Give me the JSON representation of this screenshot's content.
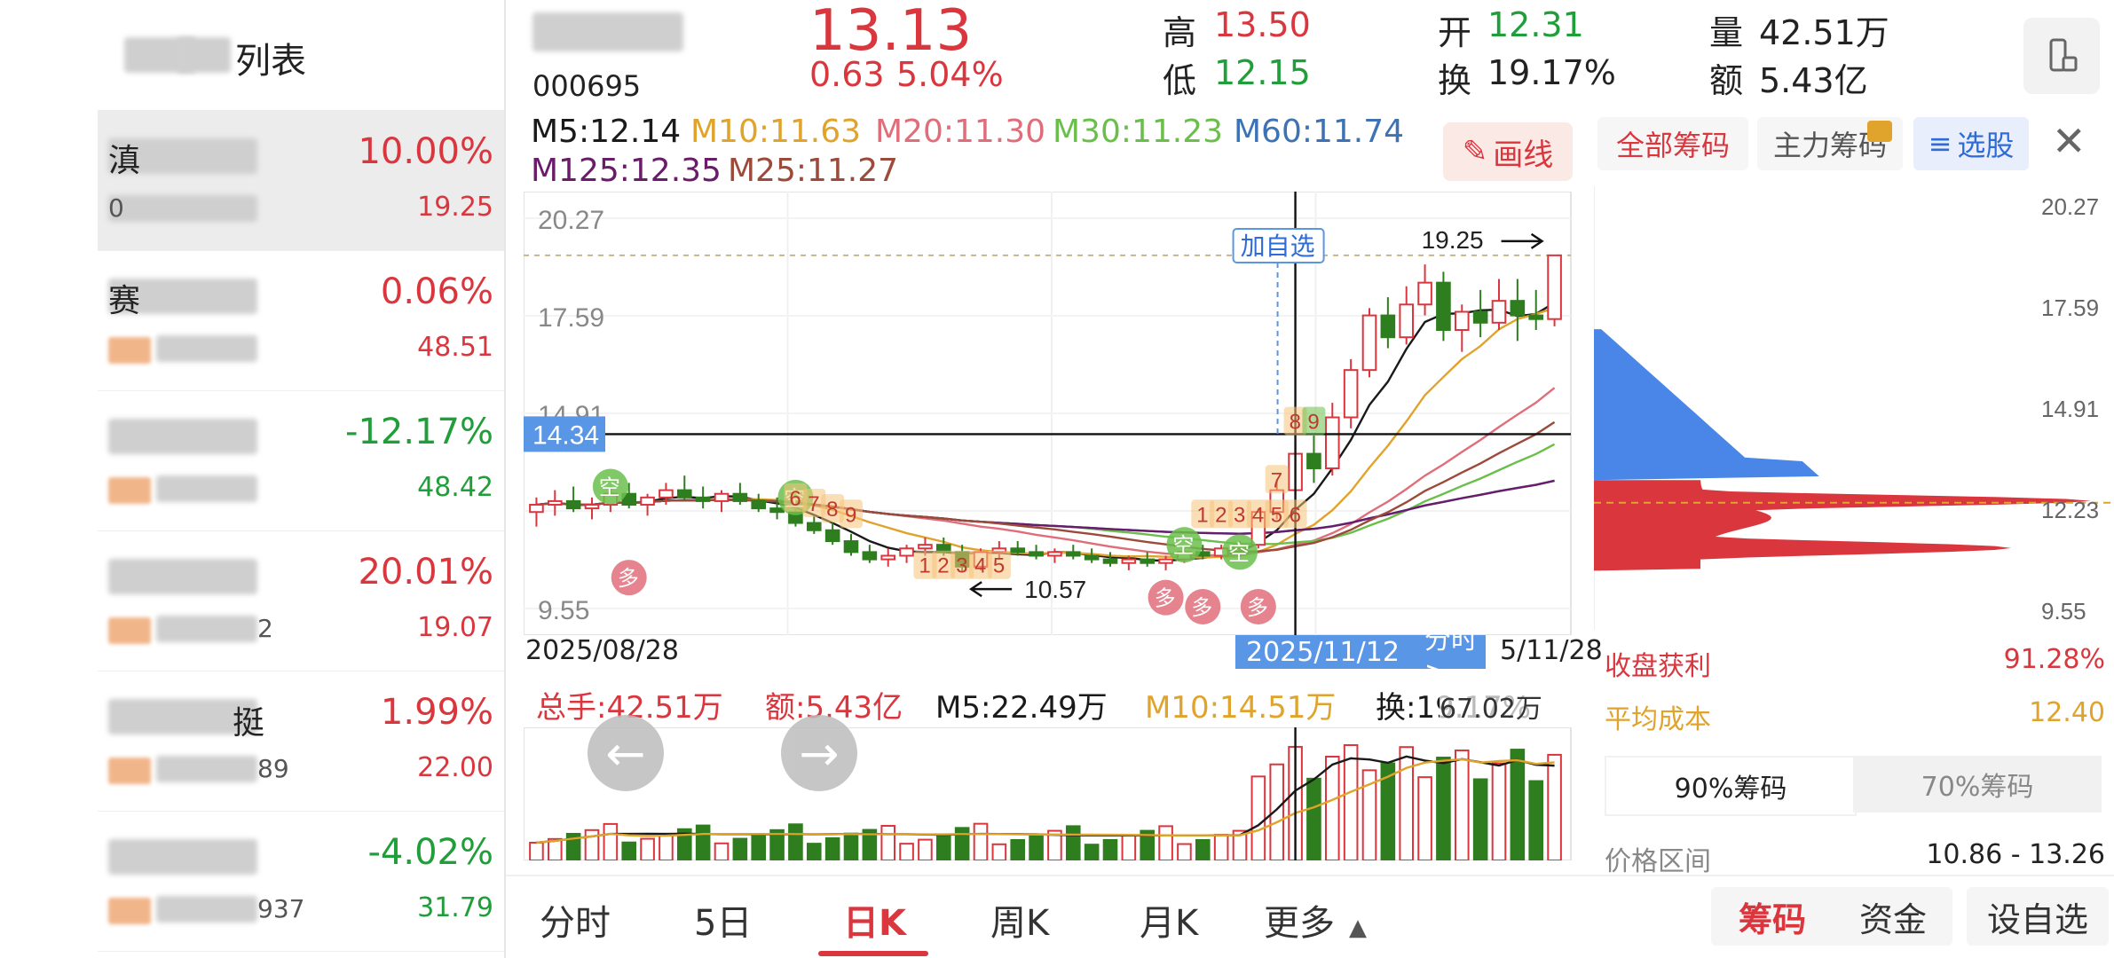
{
  "left_panel": {
    "title": "列表",
    "items": [
      {
        "first_char": "滇",
        "name_tail": "",
        "code_prefix": "0",
        "code_tail": "",
        "pct": "10.00%",
        "price": "19.25",
        "dir": "up",
        "selected": true
      },
      {
        "first_char": "赛",
        "name_tail": "",
        "code_prefix": "",
        "code_tail": "",
        "pct": "0.06%",
        "price": "48.51",
        "dir": "up",
        "selected": false
      },
      {
        "first_char": "",
        "name_tail": "",
        "code_prefix": "",
        "code_tail": "",
        "pct": "-12.17%",
        "price": "48.42",
        "dir": "down",
        "selected": false
      },
      {
        "first_char": "",
        "name_tail": "",
        "code_prefix": "",
        "code_tail": "2",
        "pct": "20.01%",
        "price": "19.07",
        "dir": "up",
        "selected": false
      },
      {
        "first_char": "",
        "name_tail": "挺",
        "code_prefix": "",
        "code_tail": "89",
        "pct": "1.99%",
        "price": "22.00",
        "dir": "up",
        "selected": false
      },
      {
        "first_char": "",
        "name_tail": "",
        "code_prefix": "",
        "code_tail": "937",
        "pct": "-4.02%",
        "price": "31.79",
        "dir": "down",
        "selected": false
      }
    ]
  },
  "header": {
    "code": "000695",
    "price": "13.13",
    "change": "0.63",
    "change_pct": "5.04%",
    "high_label": "高",
    "high": "13.50",
    "low_label": "低",
    "low": "12.15",
    "open_label": "开",
    "open": "12.31",
    "turnover_label": "换",
    "turnover": "19.17%",
    "volume_label": "量",
    "volume": "42.51万",
    "amount_label": "额",
    "amount": "5.43亿"
  },
  "ma_legend": [
    {
      "text": "M5:12.14",
      "color": "#1a1a1a"
    },
    {
      "text": "M10:11.63",
      "color": "#e0a32b"
    },
    {
      "text": "M20:11.30",
      "color": "#e06d7a"
    },
    {
      "text": "M30:11.23",
      "color": "#6abf4b"
    },
    {
      "text": "M60:11.74",
      "color": "#3d73b5"
    },
    {
      "text": "M125:12.35",
      "color": "#6a1b6a"
    },
    {
      "text": "M25:11.27",
      "color": "#9c4a3a"
    }
  ],
  "draw_line_button": "画线",
  "chart": {
    "y_labels": [
      "20.27",
      "17.59",
      "14.91",
      "9.55"
    ],
    "crosshair_price": "14.34",
    "crosshair_date": "2025/11/12",
    "intraday_link": "分时 >",
    "date_start": "2025/08/28",
    "date_end": "5/11/28",
    "max_label": "19.25",
    "min_label": "10.57",
    "add_watchlist": "加自选",
    "signal_kong": "空",
    "signal_duo": "多"
  },
  "chart_data": {
    "type": "candlestick",
    "x_start": "2025/08/28",
    "x_end": "2025/11/28",
    "ylim": [
      9.55,
      20.27
    ],
    "max": 19.25,
    "min": 10.57,
    "candles": [
      [
        12.2,
        12.6,
        11.8,
        12.4
      ],
      [
        12.4,
        12.8,
        12.1,
        12.5
      ],
      [
        12.5,
        12.9,
        12.2,
        12.3
      ],
      [
        12.3,
        12.6,
        12.0,
        12.4
      ],
      [
        12.4,
        12.9,
        12.2,
        12.7
      ],
      [
        12.7,
        13.0,
        12.3,
        12.4
      ],
      [
        12.4,
        12.7,
        12.1,
        12.6
      ],
      [
        12.6,
        13.0,
        12.4,
        12.8
      ],
      [
        12.8,
        13.2,
        12.5,
        12.6
      ],
      [
        12.6,
        12.9,
        12.3,
        12.5
      ],
      [
        12.5,
        12.8,
        12.2,
        12.7
      ],
      [
        12.7,
        13.0,
        12.4,
        12.5
      ],
      [
        12.5,
        12.7,
        12.2,
        12.3
      ],
      [
        12.3,
        12.6,
        12.0,
        12.2
      ],
      [
        12.2,
        12.4,
        11.8,
        11.9
      ],
      [
        11.9,
        12.1,
        11.6,
        11.7
      ],
      [
        11.7,
        11.9,
        11.3,
        11.4
      ],
      [
        11.4,
        11.6,
        11.0,
        11.1
      ],
      [
        11.1,
        11.3,
        10.8,
        10.9
      ],
      [
        10.9,
        11.2,
        10.7,
        11.0
      ],
      [
        11.0,
        11.3,
        10.8,
        11.2
      ],
      [
        11.2,
        11.5,
        11.0,
        11.3
      ],
      [
        11.3,
        11.5,
        11.0,
        11.1
      ],
      [
        11.1,
        11.3,
        10.57,
        10.7
      ],
      [
        10.7,
        11.2,
        10.6,
        11.1
      ],
      [
        11.1,
        11.4,
        10.9,
        11.2
      ],
      [
        11.2,
        11.4,
        11.0,
        11.1
      ],
      [
        11.1,
        11.3,
        10.9,
        11.0
      ],
      [
        11.0,
        11.2,
        10.8,
        11.1
      ],
      [
        11.1,
        11.3,
        10.9,
        11.0
      ],
      [
        11.0,
        11.2,
        10.8,
        10.9
      ],
      [
        10.9,
        11.1,
        10.7,
        10.8
      ],
      [
        10.8,
        11.0,
        10.6,
        10.9
      ],
      [
        10.9,
        11.1,
        10.7,
        10.8
      ],
      [
        10.8,
        11.0,
        10.6,
        10.9
      ],
      [
        10.9,
        11.2,
        10.8,
        11.1
      ],
      [
        11.1,
        11.3,
        10.9,
        11.0
      ],
      [
        11.0,
        11.3,
        10.9,
        11.2
      ],
      [
        11.2,
        11.4,
        11.0,
        11.3
      ],
      [
        11.3,
        12.3,
        11.2,
        12.2
      ],
      [
        12.2,
        13.1,
        12.0,
        12.8
      ],
      [
        12.8,
        14.1,
        12.6,
        13.8
      ],
      [
        13.8,
        14.3,
        13.0,
        13.4
      ],
      [
        13.4,
        15.2,
        13.2,
        14.8
      ],
      [
        14.8,
        16.4,
        14.5,
        16.1
      ],
      [
        16.1,
        17.8,
        15.9,
        17.6
      ],
      [
        17.6,
        18.1,
        16.7,
        17.0
      ],
      [
        17.0,
        18.4,
        16.8,
        17.9
      ],
      [
        17.9,
        19.0,
        17.6,
        18.5
      ],
      [
        18.5,
        18.8,
        16.9,
        17.2
      ],
      [
        17.2,
        17.9,
        16.6,
        17.7
      ],
      [
        17.7,
        18.3,
        17.0,
        17.4
      ],
      [
        17.4,
        18.6,
        17.2,
        18.0
      ],
      [
        18.0,
        18.6,
        16.9,
        17.6
      ],
      [
        17.6,
        18.3,
        17.2,
        17.5
      ],
      [
        17.5,
        19.25,
        17.3,
        19.25
      ]
    ]
  },
  "volume": {
    "total_label": "总手:42.51万",
    "amount_label": "额:5.43亿",
    "m5_label": "M5:22.49万",
    "m10_label": "M10:14.51万",
    "turnover_label": "换:19.17%",
    "max_label": "67.02万"
  },
  "chip": {
    "tabs": [
      "全部筹码",
      "主力筹码",
      "选股"
    ],
    "y_labels": [
      "20.27",
      "17.59",
      "14.91",
      "12.23",
      "9.55"
    ],
    "profit_label": "收盘获利",
    "profit": "91.28%",
    "avgcost_label": "平均成本",
    "avgcost": "12.40",
    "pct_tabs": [
      "90%筹码",
      "70%筹码"
    ],
    "range_label": "价格区间",
    "range": "10.86 - 13.26"
  },
  "bottom_tabs": [
    "分时",
    "5日",
    "日K",
    "周K",
    "月K",
    "更多"
  ],
  "bottom_buttons": [
    "筹码",
    "资金",
    "设自选"
  ]
}
